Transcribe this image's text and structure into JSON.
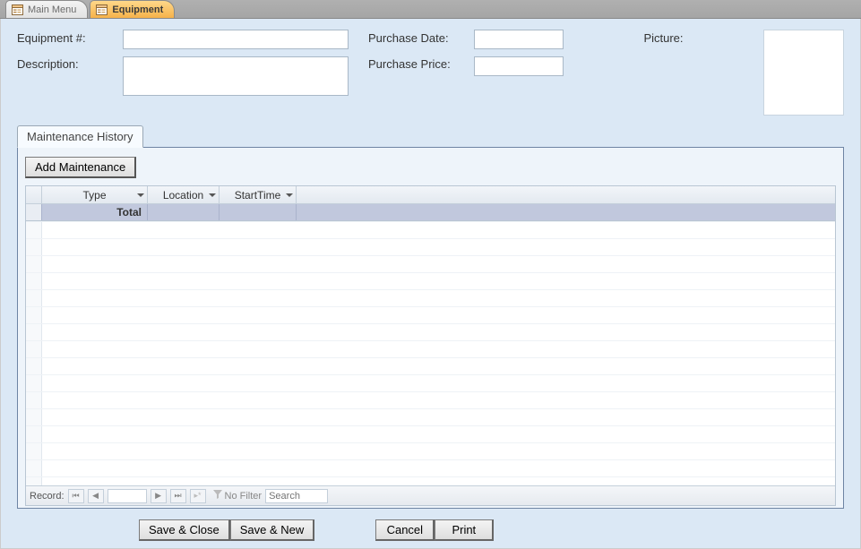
{
  "tabs": {
    "main_menu": "Main Menu",
    "equipment": "Equipment"
  },
  "header": {
    "equipment_no_label": "Equipment #:",
    "equipment_no_value": "",
    "description_label": "Description:",
    "description_value": "",
    "purchase_date_label": "Purchase Date:",
    "purchase_date_value": "",
    "purchase_price_label": "Purchase Price:",
    "purchase_price_value": "",
    "picture_label": "Picture:"
  },
  "subform": {
    "tab_label": "Maintenance History",
    "add_button": "Add Maintenance",
    "columns": {
      "type": "Type",
      "location": "Location",
      "start_time": "StartTime"
    },
    "total_label": "Total"
  },
  "recnav": {
    "label": "Record:",
    "no_filter": "No Filter",
    "search_placeholder": "Search"
  },
  "footer": {
    "save_close": "Save & Close",
    "save_new": "Save & New",
    "cancel": "Cancel",
    "print": "Print"
  }
}
